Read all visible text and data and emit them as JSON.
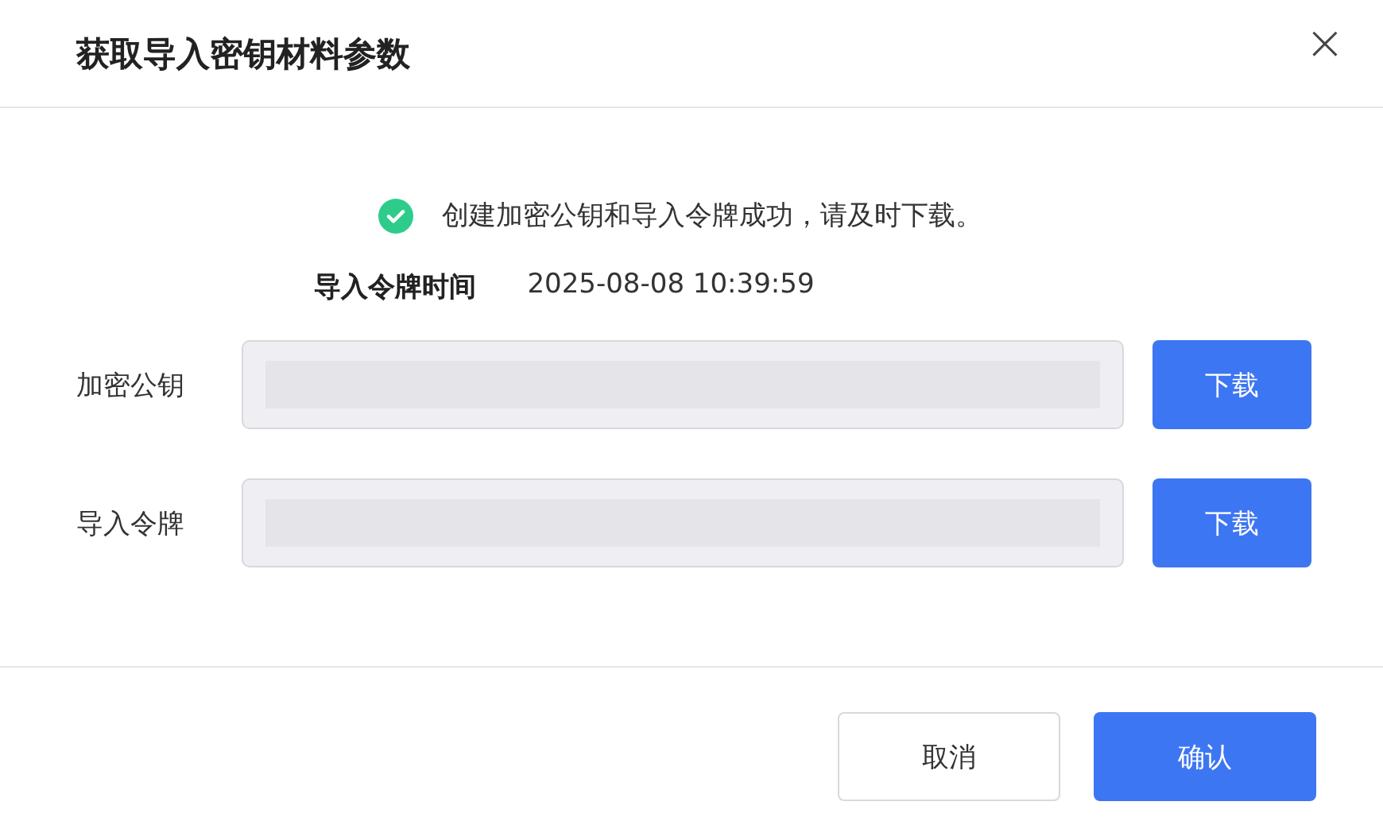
{
  "dialog": {
    "title": "获取导入密钥材料参数",
    "close": "×"
  },
  "message": {
    "kind": "success",
    "text": "创建加密公钥和导入令牌成功，请及时下载。"
  },
  "token_time": {
    "label": "导入令牌时间",
    "value": "2025-08-08 10:39:59"
  },
  "fields": [
    {
      "label": "加密公钥",
      "disabled": true,
      "button": "下载"
    },
    {
      "label": "导入令牌",
      "disabled": true,
      "button": "下载"
    }
  ],
  "buttons": [
    {
      "label": "取消",
      "kind": "secondary"
    },
    {
      "label": "确认",
      "kind": "primary"
    }
  ]
}
